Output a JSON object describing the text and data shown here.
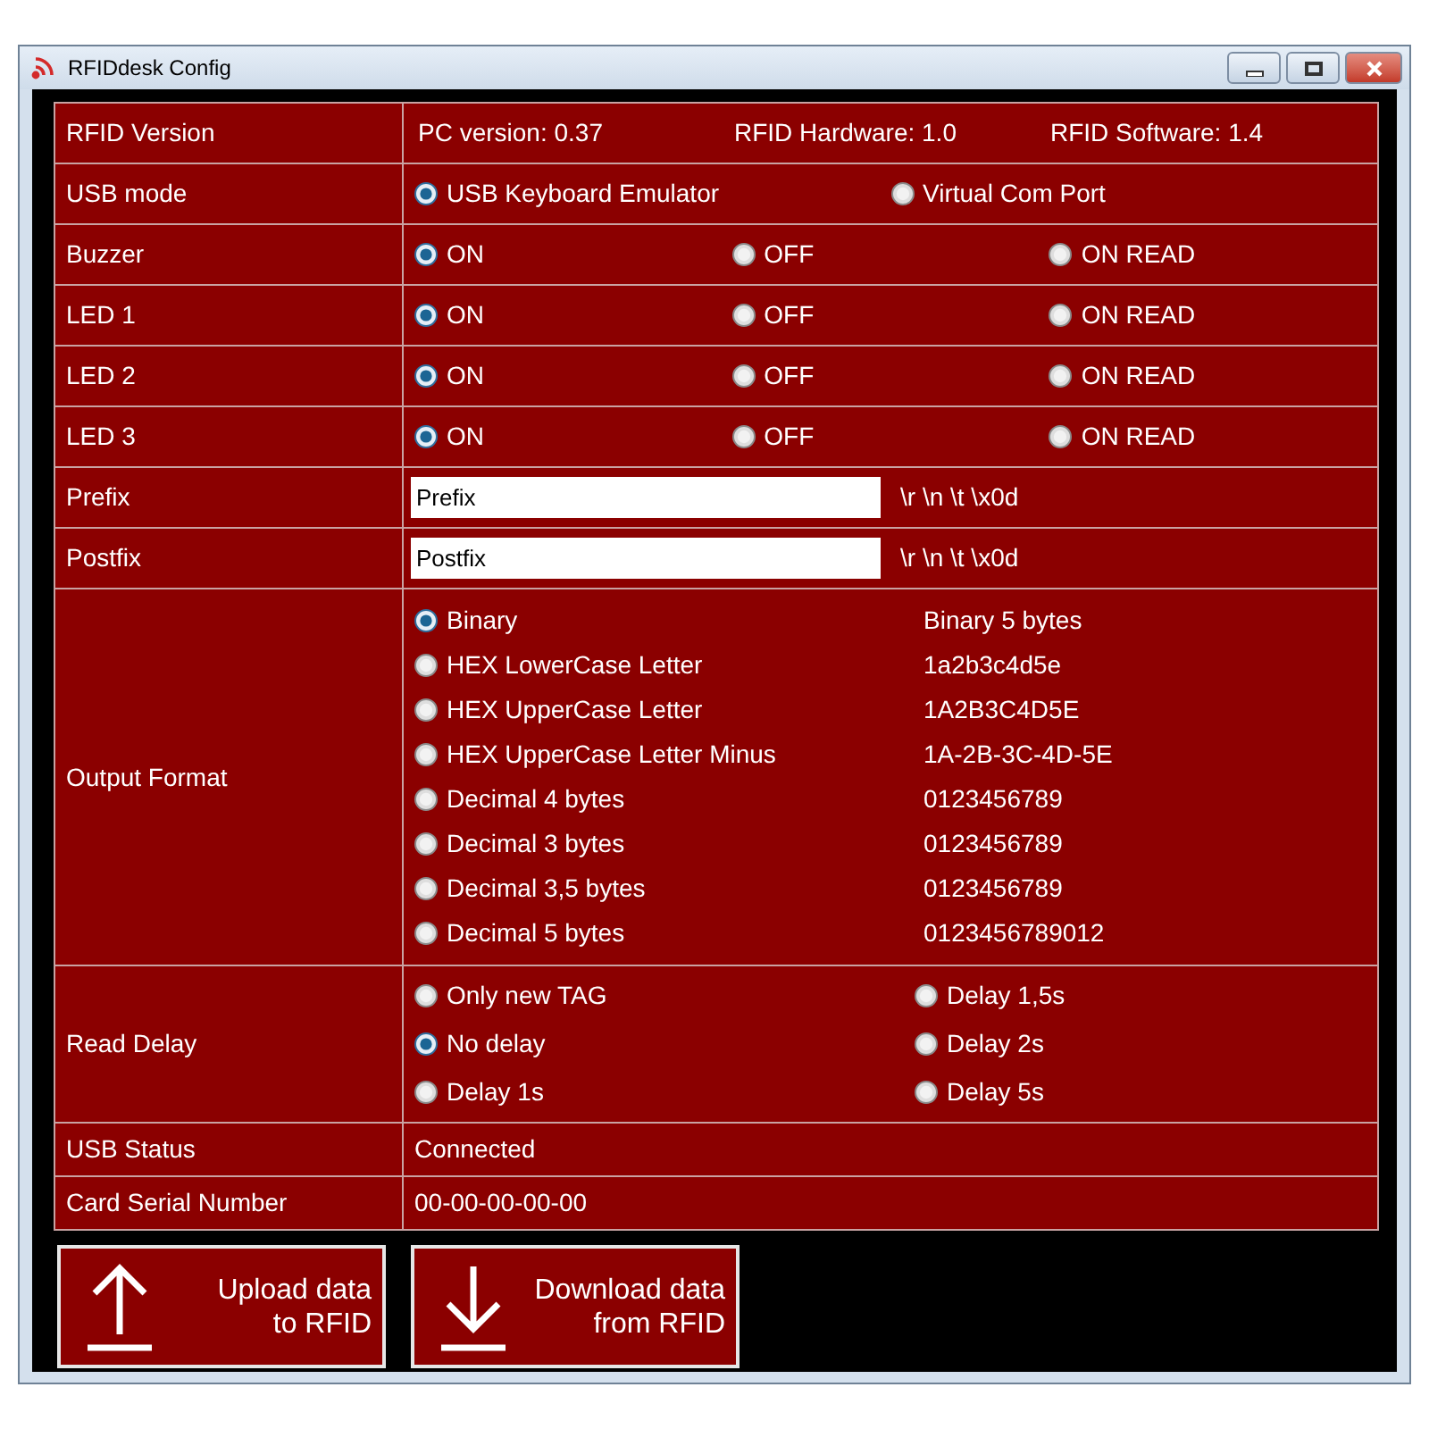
{
  "window": {
    "title": "RFIDdesk Config"
  },
  "rows": [
    {
      "kind": "info",
      "label": "RFID Version",
      "values": [
        "PC version: 0.37",
        "RFID Hardware: 1.0",
        "RFID Software: 1.4"
      ]
    },
    {
      "kind": "radio_row",
      "label": "USB mode",
      "options": [
        {
          "label": "USB Keyboard Emulator",
          "selected": true
        },
        {
          "label": "Virtual Com Port",
          "selected": false
        }
      ]
    },
    {
      "kind": "radio_row",
      "label": "Buzzer",
      "options": [
        {
          "label": "ON",
          "selected": true
        },
        {
          "label": "OFF",
          "selected": false
        },
        {
          "label": "ON READ",
          "selected": false
        }
      ]
    },
    {
      "kind": "radio_row",
      "label": "LED 1",
      "options": [
        {
          "label": "ON",
          "selected": true
        },
        {
          "label": "OFF",
          "selected": false
        },
        {
          "label": "ON READ",
          "selected": false
        }
      ]
    },
    {
      "kind": "radio_row",
      "label": "LED 2",
      "options": [
        {
          "label": "ON",
          "selected": true
        },
        {
          "label": "OFF",
          "selected": false
        },
        {
          "label": "ON READ",
          "selected": false
        }
      ]
    },
    {
      "kind": "radio_row",
      "label": "LED 3",
      "options": [
        {
          "label": "ON",
          "selected": true
        },
        {
          "label": "OFF",
          "selected": false
        },
        {
          "label": "ON READ",
          "selected": false
        }
      ]
    },
    {
      "kind": "text_input",
      "label": "Prefix",
      "value": "Prefix",
      "escape_codes": "\\r \\n \\t \\x0d"
    },
    {
      "kind": "text_input",
      "label": "Postfix",
      "value": "Postfix",
      "escape_codes": "\\r \\n \\t \\x0d"
    },
    {
      "kind": "radio_list",
      "label": "Output Format",
      "options": [
        {
          "label": "Binary",
          "example": "Binary 5 bytes",
          "selected": true
        },
        {
          "label": "HEX LowerCase Letter",
          "example": "1a2b3c4d5e",
          "selected": false
        },
        {
          "label": "HEX UpperCase Letter",
          "example": "1A2B3C4D5E",
          "selected": false
        },
        {
          "label": "HEX UpperCase Letter Minus",
          "example": "1A-2B-3C-4D-5E",
          "selected": false
        },
        {
          "label": "Decimal 4 bytes",
          "example": "0123456789",
          "selected": false
        },
        {
          "label": "Decimal 3 bytes",
          "example": "0123456789",
          "selected": false
        },
        {
          "label": "Decimal 3,5 bytes",
          "example": "0123456789",
          "selected": false
        },
        {
          "label": "Decimal 5 bytes",
          "example": "0123456789012",
          "selected": false
        }
      ]
    },
    {
      "kind": "radio_grid",
      "label": "Read Delay",
      "options": [
        {
          "label": "Only new TAG",
          "selected": false
        },
        {
          "label": "No delay",
          "selected": true
        },
        {
          "label": "Delay 1s",
          "selected": false
        },
        {
          "label": "Delay 1,5s",
          "selected": false
        },
        {
          "label": "Delay 2s",
          "selected": false
        },
        {
          "label": "Delay 5s",
          "selected": false
        }
      ]
    },
    {
      "kind": "value",
      "label": "USB Status",
      "value": "Connected"
    },
    {
      "kind": "value",
      "label": "Card Serial Number",
      "value": "00-00-00-00-00"
    }
  ],
  "buttons": [
    {
      "kind": "upload",
      "lines": [
        "Upload data",
        "to RFID"
      ]
    },
    {
      "kind": "download",
      "lines": [
        "Download data",
        "from RFID"
      ]
    }
  ]
}
